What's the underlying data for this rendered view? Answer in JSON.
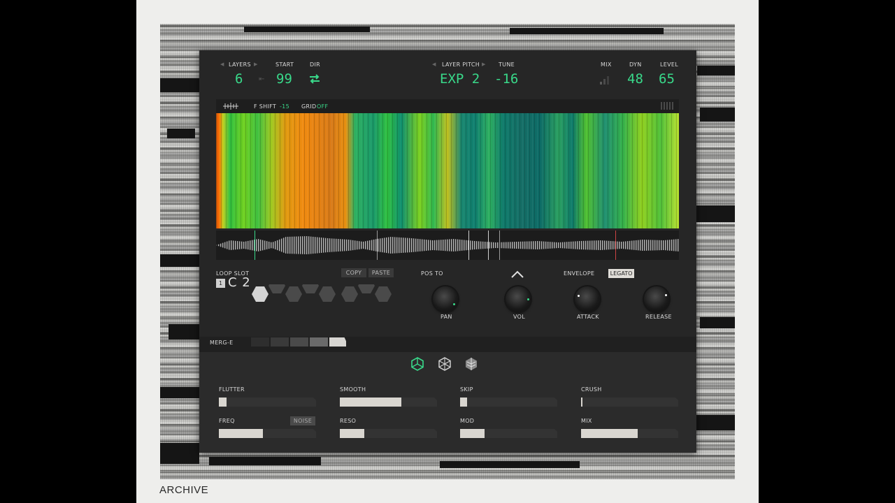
{
  "footer": {
    "archive_label": "ARCHIVE"
  },
  "header": {
    "layers": {
      "label": "LAYERS",
      "value": "6"
    },
    "start": {
      "label": "START",
      "value": "99"
    },
    "dir": {
      "label": "DIR",
      "icon": "swap-arrows-icon"
    },
    "layer_pitch": {
      "label": "LAYER PITCH",
      "value": "EXP 2"
    },
    "tune": {
      "label": "TUNE",
      "value": "-16"
    },
    "mix": {
      "label": "MIX",
      "icon": "signal-bars-icon"
    },
    "dyn": {
      "label": "DYN",
      "value": "48"
    },
    "level": {
      "label": "LEVEL",
      "value": "65"
    }
  },
  "spectrum_bar": {
    "f_shift_label": "F SHIFT",
    "f_shift_value": "-15",
    "grid_label": "GRID",
    "grid_value": "OFF"
  },
  "loop": {
    "label": "LOOP SLOT",
    "slot_number": "1",
    "note": "C 2",
    "copy_label": "COPY",
    "paste_label": "PASTE"
  },
  "pos_to": {
    "label": "POS TO"
  },
  "knobs": [
    {
      "label": "PAN"
    },
    {
      "label": "VOL"
    },
    {
      "label": "ATTACK"
    },
    {
      "label": "RELEASE"
    }
  ],
  "envelope": {
    "label": "ENVELOPE",
    "legato_label": "LEGATO"
  },
  "merge": {
    "label": "MERG-E"
  },
  "effects": [
    {
      "label": "FLUTTER",
      "value": 0.08
    },
    {
      "label": "SMOOTH",
      "value": 0.63
    },
    {
      "label": "SKIP",
      "value": 0.07
    },
    {
      "label": "CRUSH",
      "value": 0.01
    },
    {
      "label": "FREQ",
      "value": 0.45
    },
    {
      "label": "RESO",
      "value": 0.25
    },
    {
      "label": "MOD",
      "value": 0.25
    },
    {
      "label": "MIX",
      "value": 0.58
    }
  ],
  "noise_label": "NOISE",
  "colors": {
    "accent": "#39d98a",
    "panel": "#2b2b2b"
  }
}
